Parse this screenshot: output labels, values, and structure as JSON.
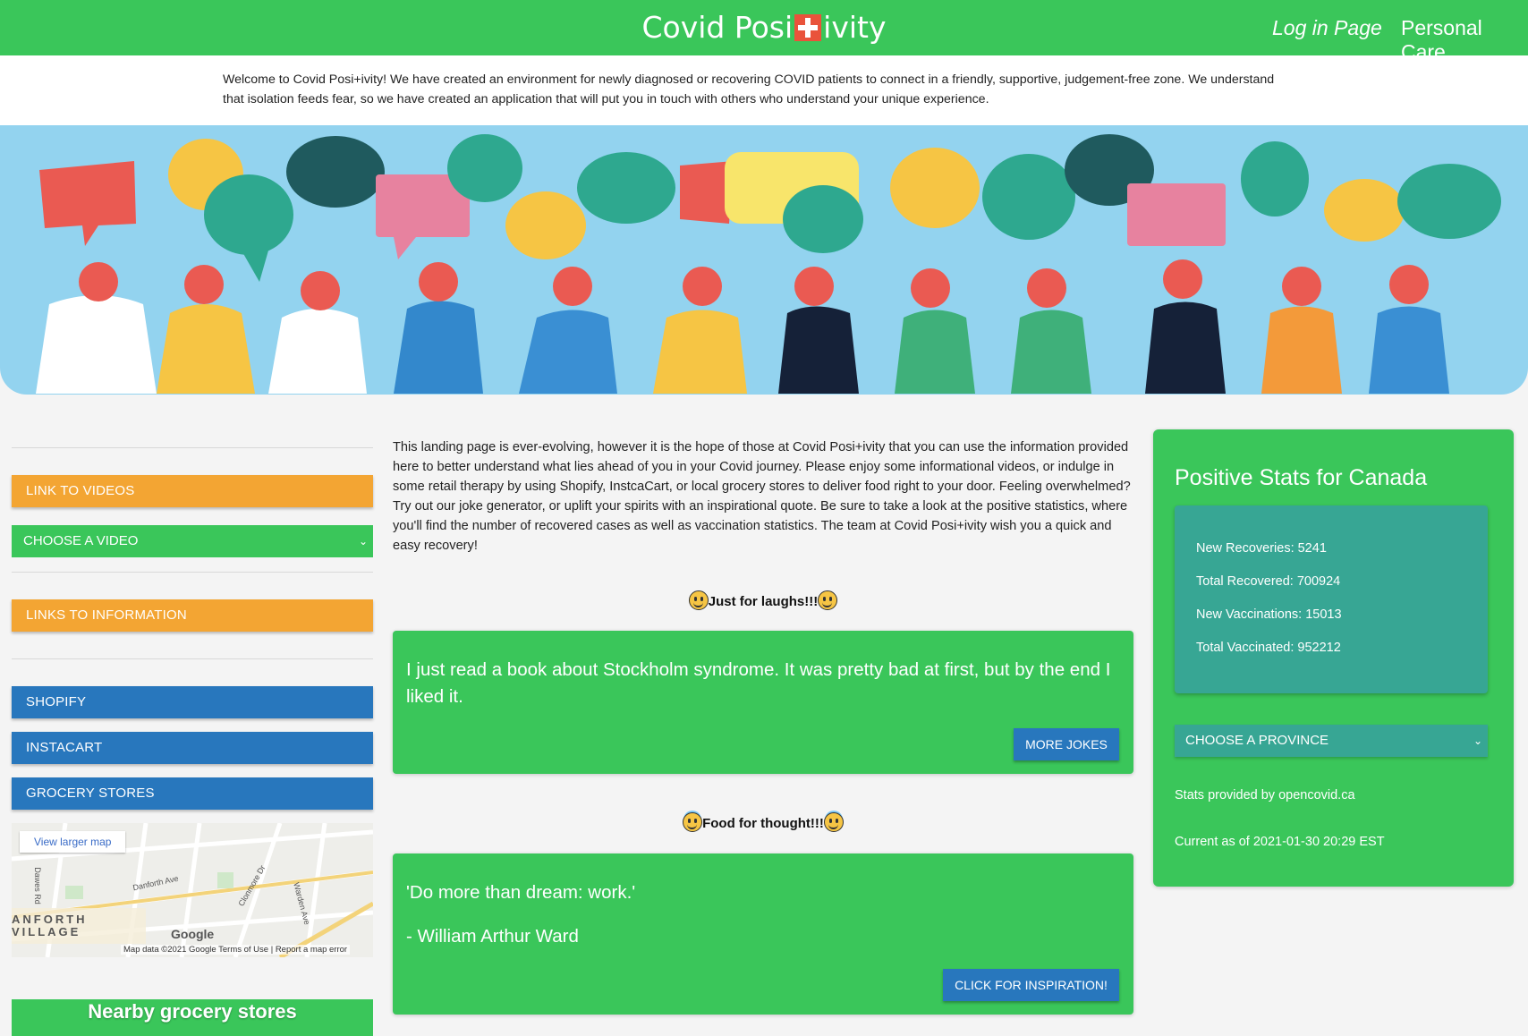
{
  "navbar": {
    "brand_left": "Covid Posi",
    "brand_right": "ivity",
    "login_link": "Log in Page",
    "care_link": "Personal Care"
  },
  "welcome_text": "Welcome to Covid Posi+ivity! We have created an environment for newly diagnosed or recovering COVID patients to connect in a friendly, supportive, judgement-free zone. We understand that isolation feeds fear, so we have created an application that will put you in touch with others who understand your unique experience.",
  "sidebar": {
    "videos_button": "LINK TO VIDEOS",
    "video_select": "CHOOSE A VIDEO",
    "info_button": "LINKS TO INFORMATION",
    "shopify_button": "SHOPIFY",
    "instacart_button": "INSTACART",
    "grocery_button": "GROCERY STORES",
    "map": {
      "larger_link": "View larger map",
      "area_line1": "ANFORTH",
      "area_line2": "VILLAGE",
      "street_danforth": "Danforth Ave",
      "street_dawes": "Dawes Rd",
      "street_clonmore": "Clonmore Dr",
      "street_warden": "Warden Ave",
      "logo": "Google",
      "footer": "Map data ©2021 Google   Terms of Use  |  Report a map error"
    },
    "nearby_label": "Nearby grocery stores"
  },
  "main": {
    "intro": "This landing page is ever-evolving, however it is the hope of those at Covid Posi+ivity that you can use the information provided here to better understand what lies ahead of you in your Covid journey. Please enjoy some informational videos, or indulge in some retail therapy by using Shopify, InstcaCart, or local grocery stores to deliver food right to your door. Feeling overwhelmed? Try out our joke generator, or uplift your spirits with an inspirational quote. Be sure to take a look at the positive statistics, where you'll find the number of recovered cases as well as vaccination statistics. The team at Covid Posi+ivity wish you a quick and easy recovery!",
    "jokes_heading": "Just for laughs!!!",
    "joke_text": "I just read a book about Stockholm syndrome. It was pretty bad at first, but by the end I liked it.",
    "more_jokes_button": "MORE JOKES",
    "thought_heading": "Food for thought!!!",
    "quote_text": "'Do more than dream: work.'",
    "quote_author": "- William Arthur Ward",
    "inspiration_button": "CLICK FOR INSPIRATION!"
  },
  "stats": {
    "title": "Positive Stats for Canada",
    "new_recoveries": "New Recoveries: 5241",
    "total_recovered": "Total Recovered: 700924",
    "new_vaccinations": "New Vaccinations: 15013",
    "total_vaccinated": "Total Vaccinated: 952212",
    "province_select": "CHOOSE A PROVINCE",
    "provided_by": "Stats provided by opencovid.ca",
    "current_as_of": "Current as of 2021-01-30 20:29 EST"
  },
  "colors": {
    "brand_green": "#3ac65a",
    "orange": "#f3a533",
    "blue": "#2877bd",
    "teal": "#37a694",
    "banner_sky": "#93d3ef"
  }
}
